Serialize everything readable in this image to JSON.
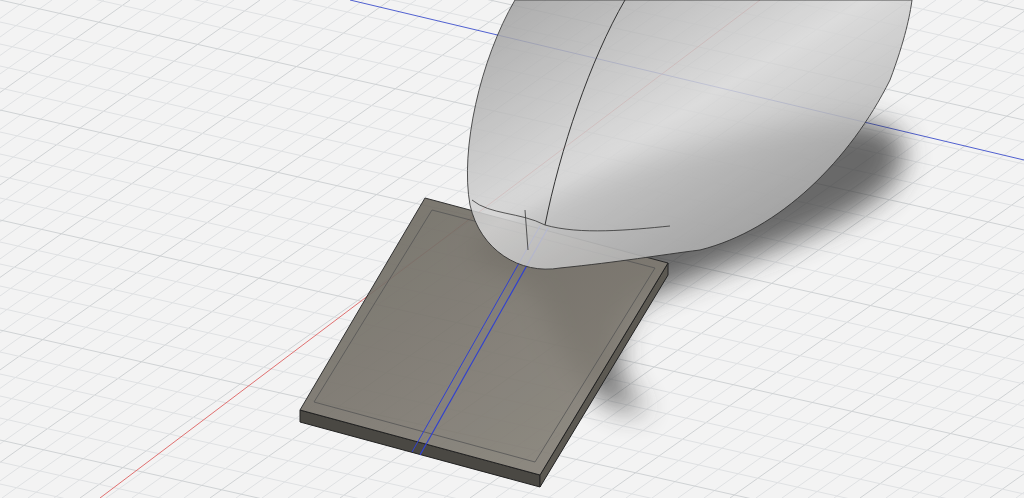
{
  "viewport": {
    "kind": "cad-3d",
    "grid_visible": true
  }
}
